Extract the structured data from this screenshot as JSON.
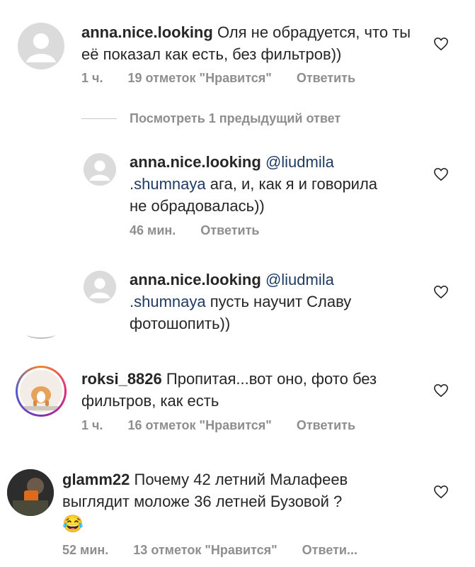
{
  "comments": [
    {
      "username": "anna.nice.looking",
      "text": "Оля не обрадуется, что ты её показал как есть, без фильтров))",
      "time": "1 ч.",
      "likes": "19 отметок \"Нравится\"",
      "reply": "Ответить"
    },
    {
      "username": "roksi_8826",
      "text": "Пропитая...вот оно, фото без фильтров, как есть",
      "time": "1 ч.",
      "likes": "16 отметок \"Нравится\"",
      "reply": "Ответить"
    },
    {
      "username": "glamm22",
      "text": "Почему 42 летний Малафеев выглядит моложе 36 летней Бузовой ?",
      "emoji": "😂",
      "time": "52 мин.",
      "likes": "13 отметок \"Нравится\"",
      "reply": "Ответи..."
    }
  ],
  "view_replies": "Посмотреть 1 предыдущий ответ",
  "replies": [
    {
      "username": "anna.nice.looking",
      "mention_line1": "@liudmila",
      "mention_line2": ".shumnaya",
      "text_after_mention": " ага, и, как я и говорила",
      "text_line3": "не обрадовалась))",
      "time": "46 мин.",
      "reply": "Ответить"
    },
    {
      "username": "anna.nice.looking",
      "mention_line1": "@liudmila",
      "mention_line2": ".shumnaya",
      "text_after_mention": " пусть научит Славу",
      "text_line3": "фотошопить))"
    }
  ],
  "icons": [
    "heart-outline-icon",
    "default-avatar-icon"
  ],
  "colors": {
    "text": "#262626",
    "meta": "#8e8e8e",
    "mention": "#1f3c63"
  }
}
